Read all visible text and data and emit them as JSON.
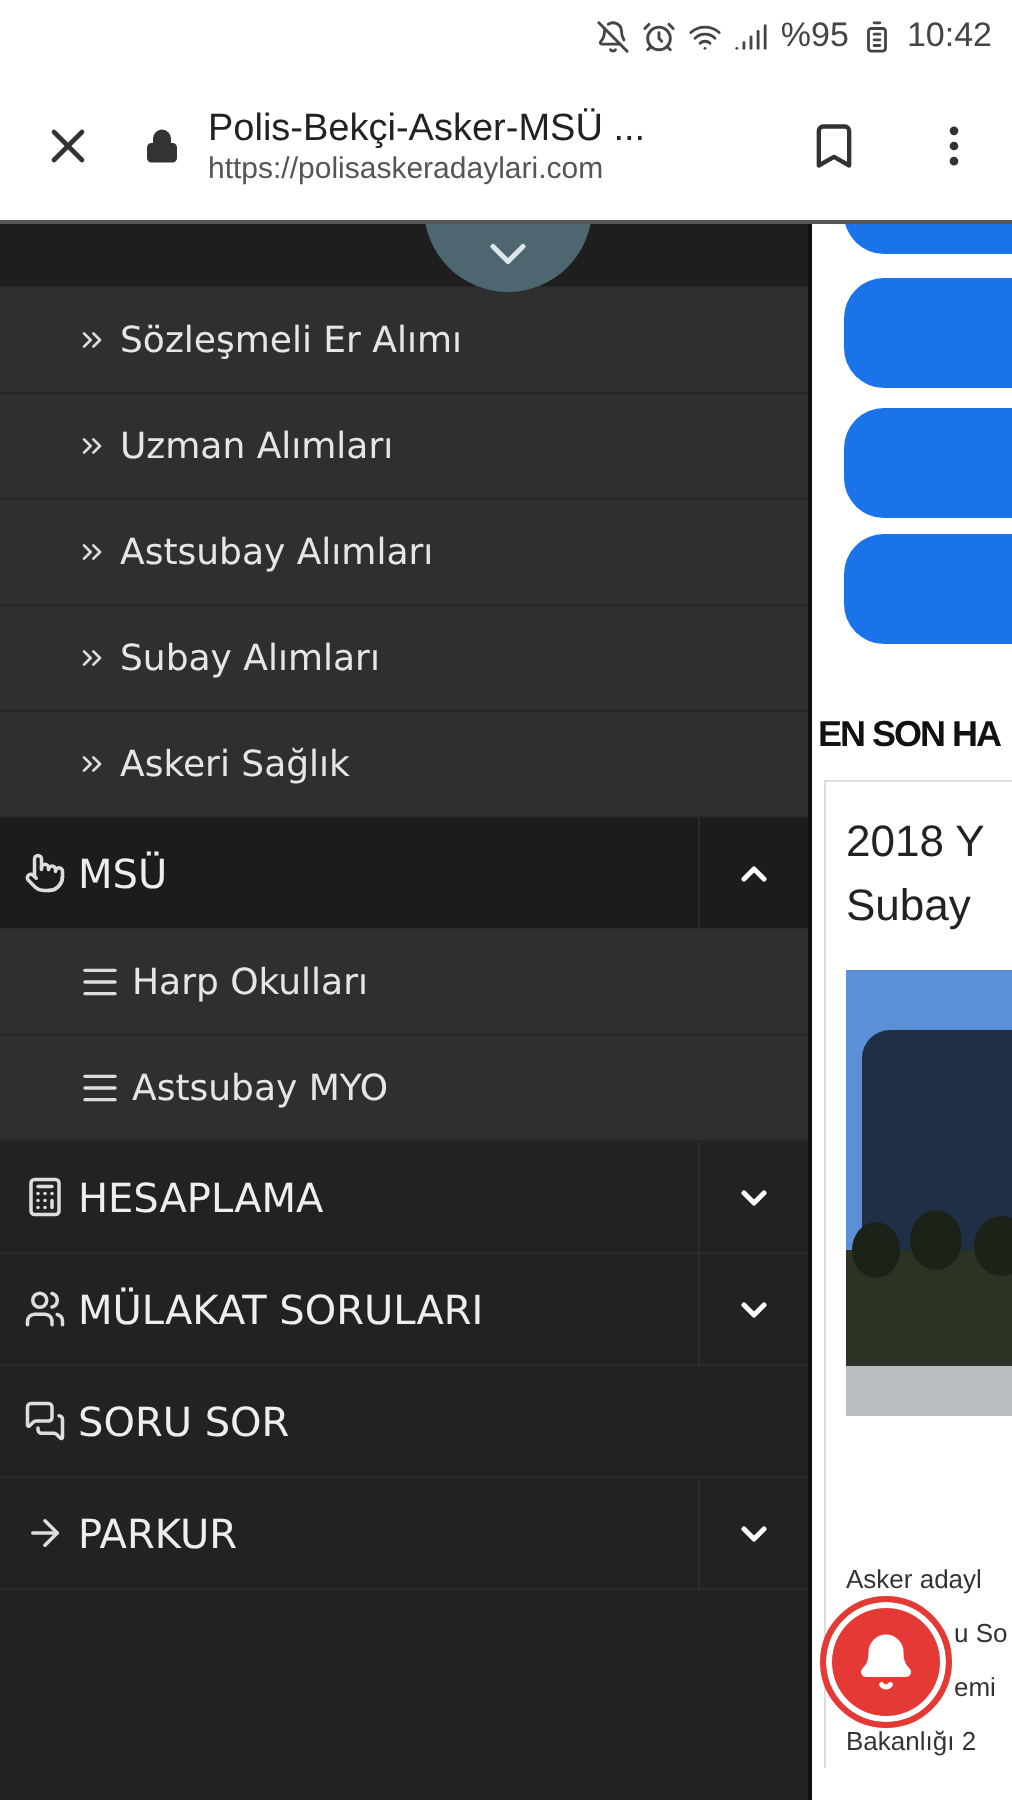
{
  "status_bar": {
    "battery": "%95",
    "time": "10:42"
  },
  "browser_bar": {
    "title": "Polis-Bekçi-Asker-MSÜ ...",
    "url": "https://polisaskeradaylari.com"
  },
  "menu": {
    "groups": [
      {
        "children": [
          {
            "label": "Sözleşmeli Er Alımı"
          },
          {
            "label": "Uzman Alımları"
          },
          {
            "label": "Astsubay Alımları"
          },
          {
            "label": "Subay Alımları"
          },
          {
            "label": "Askeri Sağlık"
          }
        ]
      },
      {
        "label": "MSÜ",
        "expanded": true,
        "children": [
          {
            "label": "Harp Okulları"
          },
          {
            "label": "Astsubay MYO"
          }
        ]
      },
      {
        "label": "HESAPLAMA",
        "expanded": false
      },
      {
        "label": "MÜLAKAT SORULARI",
        "expanded": false
      },
      {
        "label": "SORU SOR"
      },
      {
        "label": "PARKUR",
        "expanded": false
      }
    ]
  },
  "content": {
    "heading": "EN SON HA",
    "card": {
      "title_lines": [
        "2018 Y",
        "Subay"
      ],
      "excerpt_lines": [
        "Asker adayl",
        "u So",
        "emi",
        "Bakanlığı 2"
      ]
    }
  }
}
